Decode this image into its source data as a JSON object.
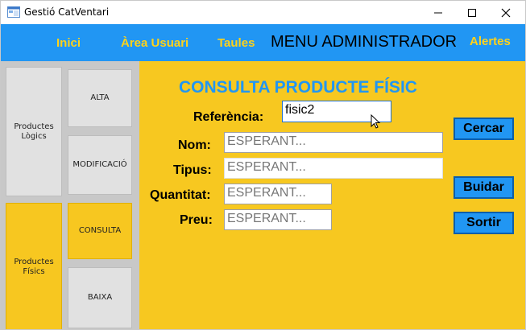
{
  "window": {
    "title": "Gestió CatVentari",
    "controls": {
      "minimize": "—",
      "maximize": "☐",
      "close": "✕"
    }
  },
  "menu": {
    "inici": "Inici",
    "area_usuari": "Àrea Usuari",
    "taules": "Taules",
    "admin_title": "MENU ADMINISTRADOR",
    "alertes": "Alertes"
  },
  "sidebar": {
    "productes_logics": "Productes Lògics",
    "productes_fisics": "Productes Físics",
    "alta": "ALTA",
    "modificacio": "MODIFICACIÓ",
    "consulta": "CONSULTA",
    "baixa": "BAIXA"
  },
  "form": {
    "title": "CONSULTA PRODUCTE FÍSIC",
    "referencia_label": "Referència:",
    "referencia_value": "fisic2",
    "nom_label": "Nom:",
    "nom_value": "ESPERANT...",
    "tipus_label": "Tipus:",
    "tipus_value": "ESPERANT...",
    "quantitat_label": "Quantitat:",
    "quantitat_value": "ESPERANT...",
    "preu_label": "Preu:",
    "preu_value": "ESPERANT..."
  },
  "actions": {
    "cercar": "Cercar",
    "buidar": "Buidar",
    "sortir": "Sortir"
  },
  "colors": {
    "menubar": "#2196f3",
    "menu_text": "#ffd21a",
    "main_bg": "#f7c820",
    "title": "#2196f3"
  },
  "icons": {
    "app": "app-window-icon",
    "cursor": "mouse-pointer-icon"
  }
}
